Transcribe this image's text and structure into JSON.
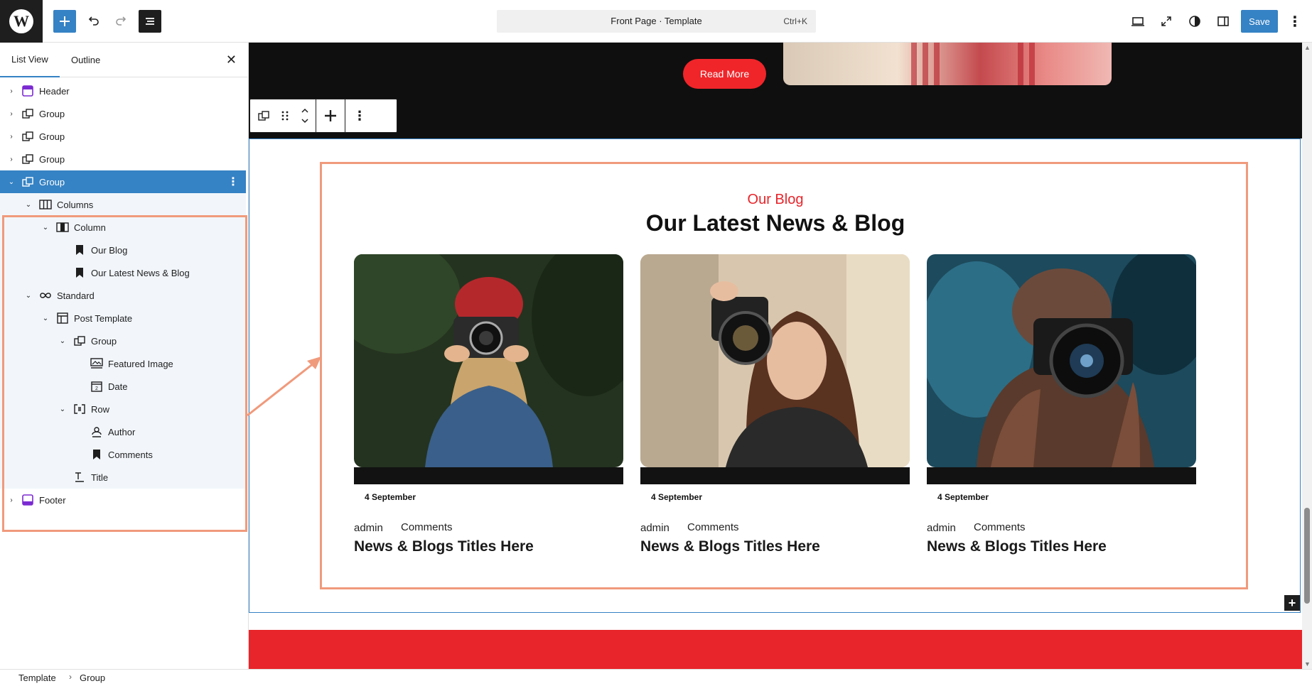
{
  "topbar": {
    "logo_letter": "W",
    "command_title": "Front Page · Template",
    "command_shortcut": "Ctrl+K",
    "save_label": "Save",
    "icons": [
      "plus-icon",
      "undo-icon",
      "redo-icon",
      "list-view-icon",
      "desktop-view-icon",
      "fullscreen-icon",
      "styles-contrast-icon",
      "sidebar-settings-icon",
      "more-options-icon"
    ]
  },
  "sidebar": {
    "tabs": [
      "List View",
      "Outline"
    ],
    "close_glyph": "✕",
    "items": [
      {
        "label": "Header",
        "icon": "header-template-icon",
        "expanded": false
      },
      {
        "label": "Group",
        "icon": "group-icon",
        "expanded": false
      },
      {
        "label": "Group",
        "icon": "group-icon",
        "expanded": false
      },
      {
        "label": "Group",
        "icon": "group-icon",
        "expanded": false
      },
      {
        "label": "Group",
        "icon": "group-icon",
        "expanded": true,
        "selected": true
      },
      {
        "label": "Columns",
        "icon": "columns-icon",
        "expanded": true
      },
      {
        "label": "Column",
        "icon": "column-icon",
        "expanded": true
      },
      {
        "label": "Our Blog",
        "icon": "bookmark-icon"
      },
      {
        "label": "Our Latest News & Blog",
        "icon": "bookmark-icon"
      },
      {
        "label": "Standard",
        "icon": "query-loop-icon",
        "expanded": true
      },
      {
        "label": "Post Template",
        "icon": "post-template-icon",
        "expanded": true
      },
      {
        "label": "Group",
        "icon": "group-icon",
        "expanded": true
      },
      {
        "label": "Featured Image",
        "icon": "featured-image-icon"
      },
      {
        "label": "Date",
        "icon": "date-icon"
      },
      {
        "label": "Row",
        "icon": "row-icon",
        "expanded": true
      },
      {
        "label": "Author",
        "icon": "author-icon"
      },
      {
        "label": "Comments",
        "icon": "bookmark-icon"
      },
      {
        "label": "Title",
        "icon": "title-icon"
      },
      {
        "label": "Footer",
        "icon": "footer-template-icon",
        "expanded": false
      }
    ]
  },
  "canvas": {
    "hero_button": "Read More",
    "eyebrow": "Our Blog",
    "section_title": "Our Latest News & Blog",
    "cards": [
      {
        "date": "4 September",
        "author": "admin",
        "comments": "Comments",
        "title": "News & Blogs Titles Here",
        "image": "woman-red-beanie-camera-photo"
      },
      {
        "date": "4 September",
        "author": "admin",
        "comments": "Comments",
        "title": "News & Blogs Titles Here",
        "image": "woman-holding-camera-photo"
      },
      {
        "date": "4 September",
        "author": "admin",
        "comments": "Comments",
        "title": "News & Blogs Titles Here",
        "image": "hands-holding-camera-photo"
      }
    ],
    "add_block_glyph": "+"
  },
  "breadcrumb": {
    "items": [
      "Template",
      "Group"
    ],
    "separator": "›"
  },
  "colors": {
    "accent_blue": "#3582c4",
    "brand_red": "#e8252a",
    "annotation_orange": "#f09a7c",
    "dark_band": "#0f0f0f"
  }
}
